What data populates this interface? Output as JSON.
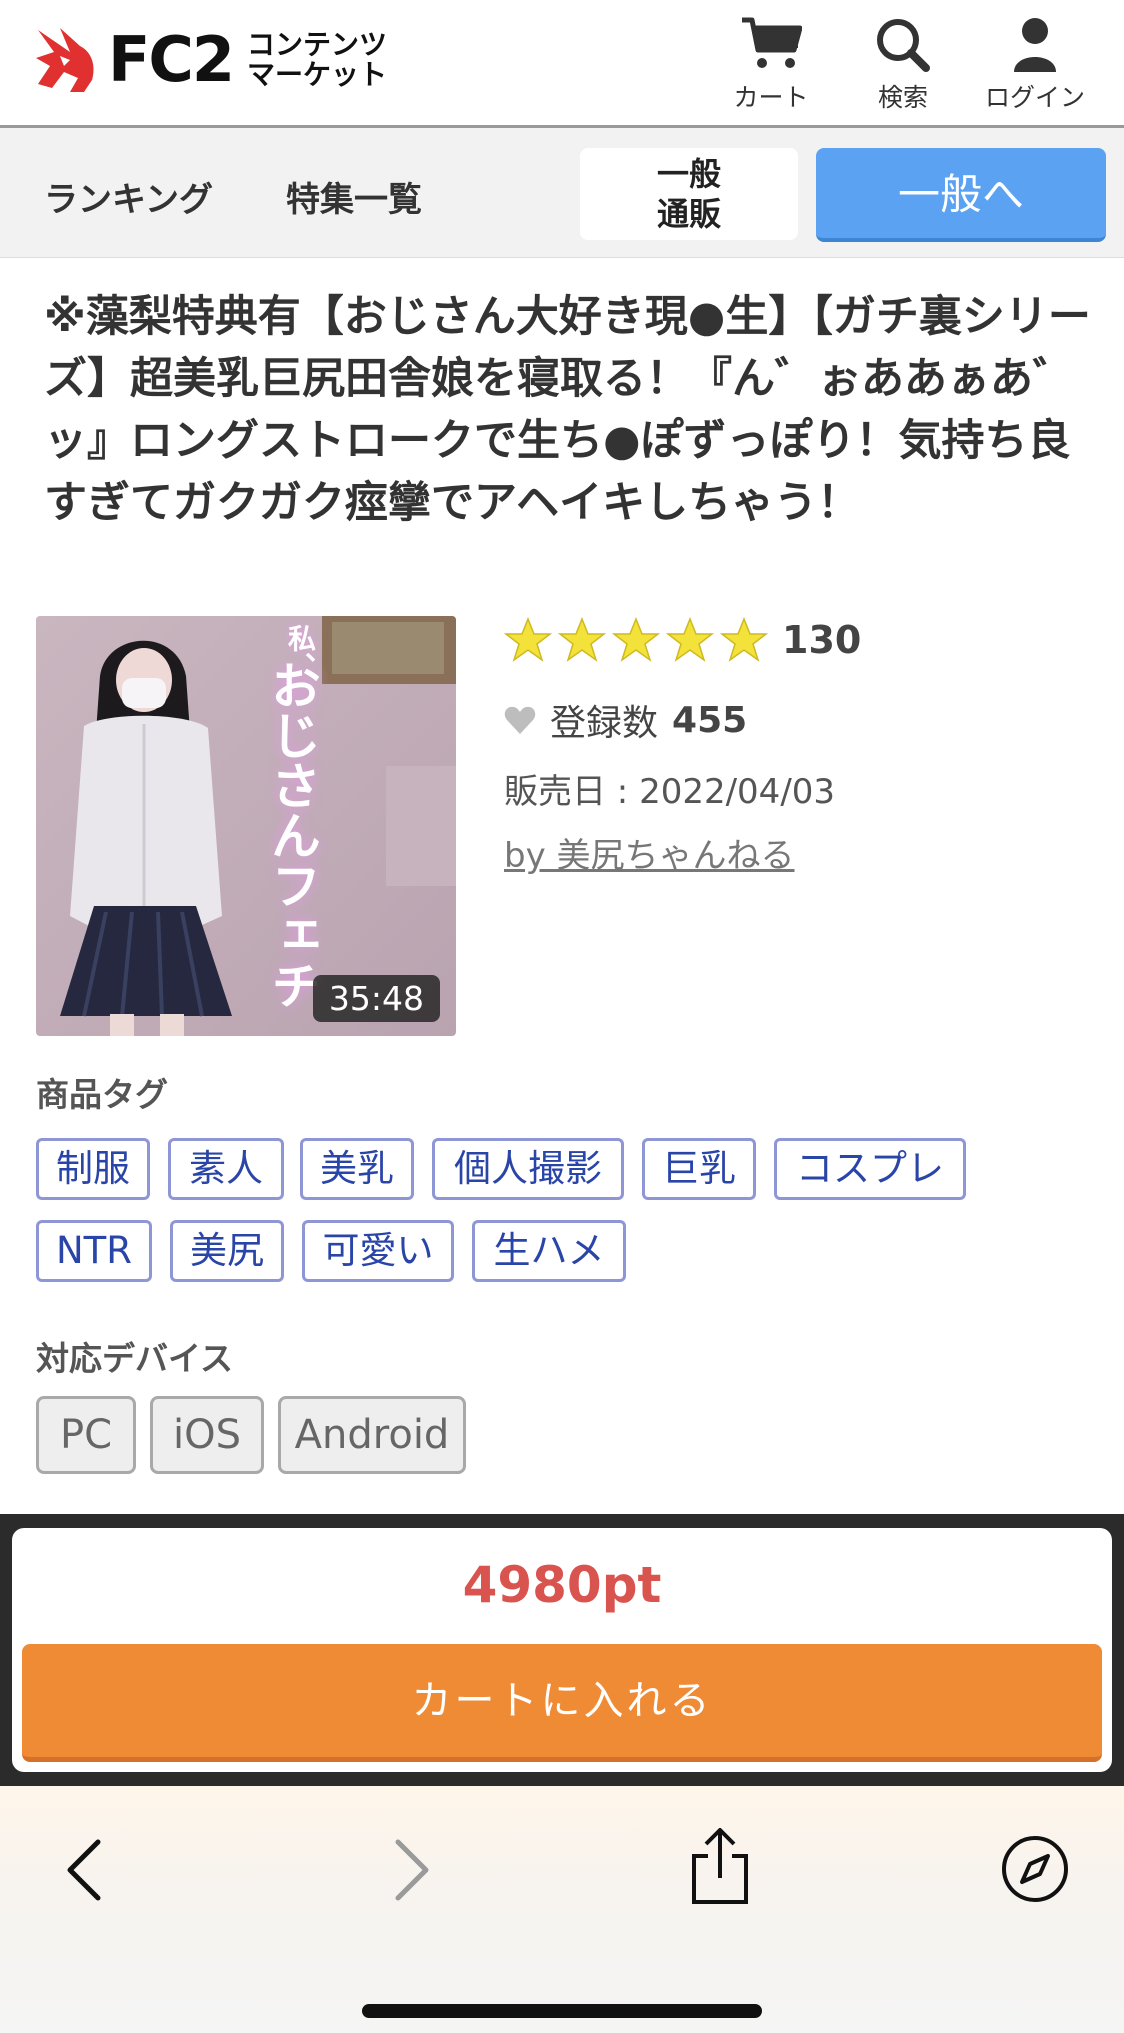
{
  "header": {
    "logo_text": "FC2",
    "logo_sub_line1": "コンテンツ",
    "logo_sub_line2": "マーケット",
    "cart_label": "カート",
    "search_label": "検索",
    "login_label": "ログイン"
  },
  "nav": {
    "ranking": "ランキング",
    "features": "特集一覧",
    "ippan_tsuhan_line1": "一般",
    "ippan_tsuhan_line2": "通販",
    "ippan_button": "一般へ"
  },
  "product": {
    "title": "※藻梨特典有【おじさん大好き現●生】【ガチ裏シリーズ】超美乳巨尻田舎娘を寝取る！『ん゛ぉああぁあ゛ッ』ロングストロークで生ち●ぽずっぽり！気持ち良すぎてガクガク痙攣でアヘイキしちゃう！",
    "thumbnail_overlay_small": "私、",
    "thumbnail_overlay": "おじさんフェチ",
    "duration": "35:48",
    "rating_stars": 5,
    "rating_count": "130",
    "favorites_label": "登録数",
    "favorites_count": "455",
    "sale_date": "販売日 : 2022/04/03",
    "seller": "by 美尻ちゃんねる"
  },
  "tags": {
    "label": "商品タグ",
    "items": [
      "制服",
      "素人",
      "美乳",
      "個人撮影",
      "巨乳",
      "コスプレ",
      "NTR",
      "美尻",
      "可愛い",
      "生ハメ"
    ]
  },
  "devices": {
    "label": "対応デバイス",
    "items": [
      "PC",
      "iOS",
      "Android"
    ]
  },
  "purchase": {
    "price": "4980pt",
    "cart_button": "カートに入れる"
  },
  "colors": {
    "accent_blue": "#5ba3f2",
    "price_red": "#d9534f",
    "cart_orange": "#ef8a35",
    "tag_blue": "#2a45a8",
    "star_yellow": "#f3e23a"
  }
}
